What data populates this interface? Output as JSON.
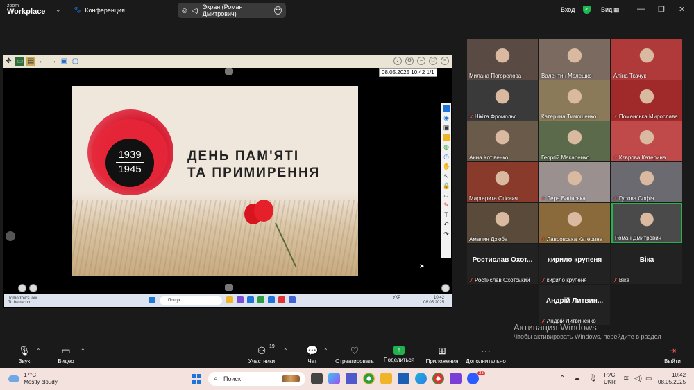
{
  "app": {
    "logo_top": "zoom",
    "logo_bottom": "Workplace",
    "meeting_label": "Конференция",
    "share_status": "Экран (Роман Дмитрович)",
    "signin_label": "Вход",
    "view_label": "Вид"
  },
  "slide": {
    "date_time": "08.05.2025  10:42",
    "page": "1/1",
    "year_top": "1939",
    "year_bottom": "1945",
    "title_line1": "ДЕНЬ ПАМ'ЯТІ",
    "title_line2": "ТА ПРИМИРЕННЯ"
  },
  "inner_taskbar": {
    "weather_line1": "Tomorrow's low",
    "weather_line2": "To be record",
    "search": "Пошук",
    "lang": "УКР",
    "time": "10:42",
    "date": "08.05.2025"
  },
  "participants": [
    {
      "name": "Милана Погорелова",
      "muted": false
    },
    {
      "name": "Валентин Мелешко",
      "muted": false
    },
    {
      "name": "Аліна Ткачук",
      "muted": false
    },
    {
      "name": "Нікіта Фромольс.",
      "muted": true
    },
    {
      "name": "Катерина Тимошенко",
      "muted": false
    },
    {
      "name": "Поманська Мирослава",
      "muted": true
    },
    {
      "name": "Анна Котівенко",
      "muted": false
    },
    {
      "name": "Георгій Макаренко",
      "muted": false
    },
    {
      "name": "Кєврова Катерина",
      "muted": true
    },
    {
      "name": "Маргарита Огієвич",
      "muted": false
    },
    {
      "name": "Лера Багінська",
      "muted": true
    },
    {
      "name": "Гурова Софія",
      "muted": true
    },
    {
      "name": "Амалия Дзюба",
      "muted": false
    },
    {
      "name": "Лавровська Катерина",
      "muted": true
    },
    {
      "name": "Роман Дмитрович",
      "muted": false
    },
    {
      "name": "Ростислав Охотський",
      "display": "Ростислав  Охот...",
      "muted": true
    },
    {
      "name": "кирило крупеня",
      "display": "кирило крупеня",
      "muted": true
    },
    {
      "name": "Віка",
      "display": "Віка",
      "muted": true
    },
    {
      "name": "Андрій Литвиненко",
      "display": "Андрій Литвин...",
      "muted": true
    }
  ],
  "watermark": {
    "title": "Активация Windows",
    "body": "Чтобы активировать Windows, перейдите в раздел \"Параметры\"."
  },
  "toolbar": {
    "audio": "Звук",
    "video": "Видео",
    "participants": "Участники",
    "participants_count": "19",
    "chat": "Чат",
    "react": "Отреагировать",
    "share": "Поделиться",
    "apps": "Приложения",
    "more": "Дополнительно",
    "leave": "Выйти"
  },
  "taskbar": {
    "temp": "17°C",
    "weather": "Mostly cloudy",
    "search": "Поиск",
    "badge": "33",
    "lang1": "РУС",
    "lang2": "UKR",
    "time": "10:42",
    "date": "08.05.2025"
  },
  "colors": {
    "zoom_green": "#24b34d",
    "mute_red": "#ff4d4d",
    "poppy_red": "#e21d2b"
  }
}
